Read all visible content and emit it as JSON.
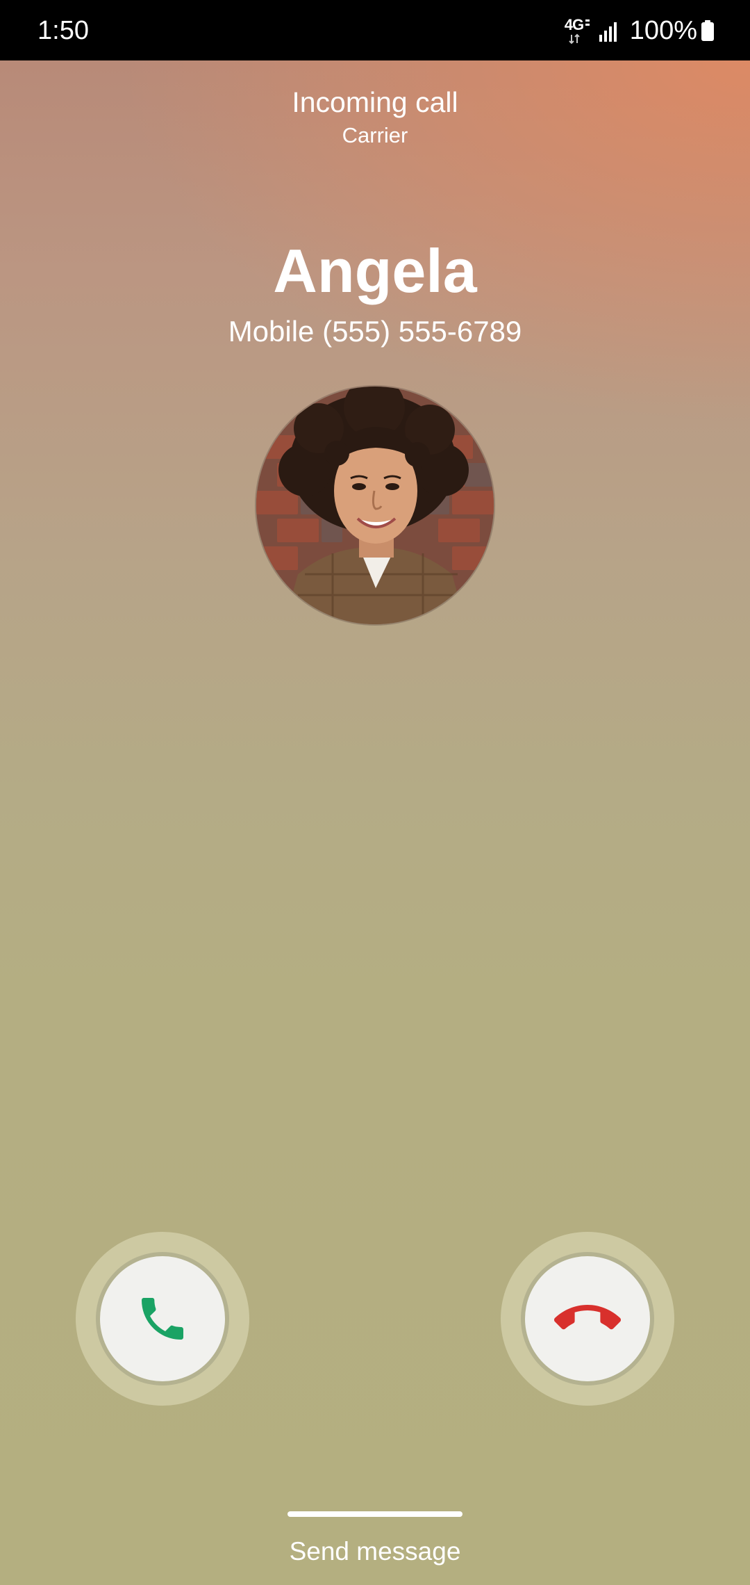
{
  "status_bar": {
    "time": "1:50",
    "network_label": "4G",
    "network_icon": "4g-lte-icon",
    "signal_icon": "signal-bars-icon",
    "battery_percent": "100%",
    "battery_icon": "battery-full-icon",
    "battery_level": 1.0
  },
  "call": {
    "status": "Incoming call",
    "carrier": "Carrier",
    "caller_name": "Angela",
    "caller_number": "Mobile (555) 555-6789",
    "avatar_icon": "contact-photo"
  },
  "actions": {
    "accept_icon": "phone-answer-icon",
    "decline_icon": "phone-hangup-icon",
    "accept_color": "#1aa364",
    "decline_color": "#d8302c",
    "send_message_label": "Send message"
  }
}
